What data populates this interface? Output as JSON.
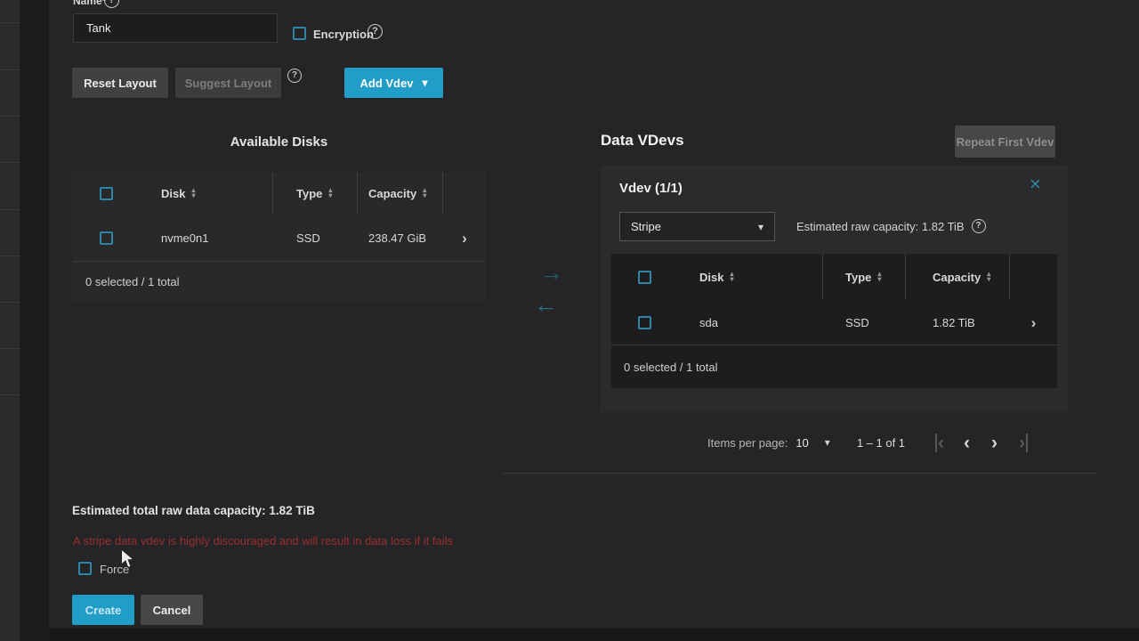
{
  "form": {
    "name_label": "Name*",
    "name_value": "Tank",
    "encryption_label": "Encryption"
  },
  "toolbar": {
    "reset_layout": "Reset Layout",
    "suggest_layout": "Suggest Layout",
    "add_vdev": "Add Vdev"
  },
  "available": {
    "title": "Available Disks",
    "columns": [
      "Disk",
      "Type",
      "Capacity"
    ],
    "rows": [
      {
        "disk": "nvme0n1",
        "type": "SSD",
        "capacity": "238.47 GiB"
      }
    ],
    "summary": "0 selected / 1 total"
  },
  "data_vdevs": {
    "title": "Data VDevs",
    "repeat_button": "Repeat First Vdev",
    "vdev": {
      "title": "Vdev (1/1)",
      "layout_select": "Stripe",
      "estimated_raw": "Estimated raw capacity: 1.82 TiB",
      "columns": [
        "Disk",
        "Type",
        "Capacity"
      ],
      "rows": [
        {
          "disk": "sda",
          "type": "SSD",
          "capacity": "1.82 TiB"
        }
      ],
      "summary": "0 selected / 1 total"
    },
    "pagination": {
      "items_per_page_label": "Items per page:",
      "items_per_page_value": "10",
      "range": "1 – 1 of 1"
    }
  },
  "footer": {
    "estimated_total": "Estimated total raw data capacity: 1.82 TiB",
    "warning": "A stripe data vdev is highly discouraged and will result in data loss if it fails",
    "force_label": "Force",
    "create": "Create",
    "cancel": "Cancel"
  },
  "icons": {
    "help": "?",
    "caret_down": "▾",
    "sort_up": "▴",
    "sort_down": "▾",
    "chevron_right": "›",
    "arrow_right": "→",
    "arrow_left": "←",
    "close": "×",
    "page_prev": "‹",
    "page_next": "›"
  },
  "colors": {
    "accent": "#219dc8",
    "checkbox_border": "#2e86a6",
    "warning": "#992e2e",
    "panel": "#252528",
    "card": "#2b2b2e",
    "table_dark": "#1d1d20"
  }
}
